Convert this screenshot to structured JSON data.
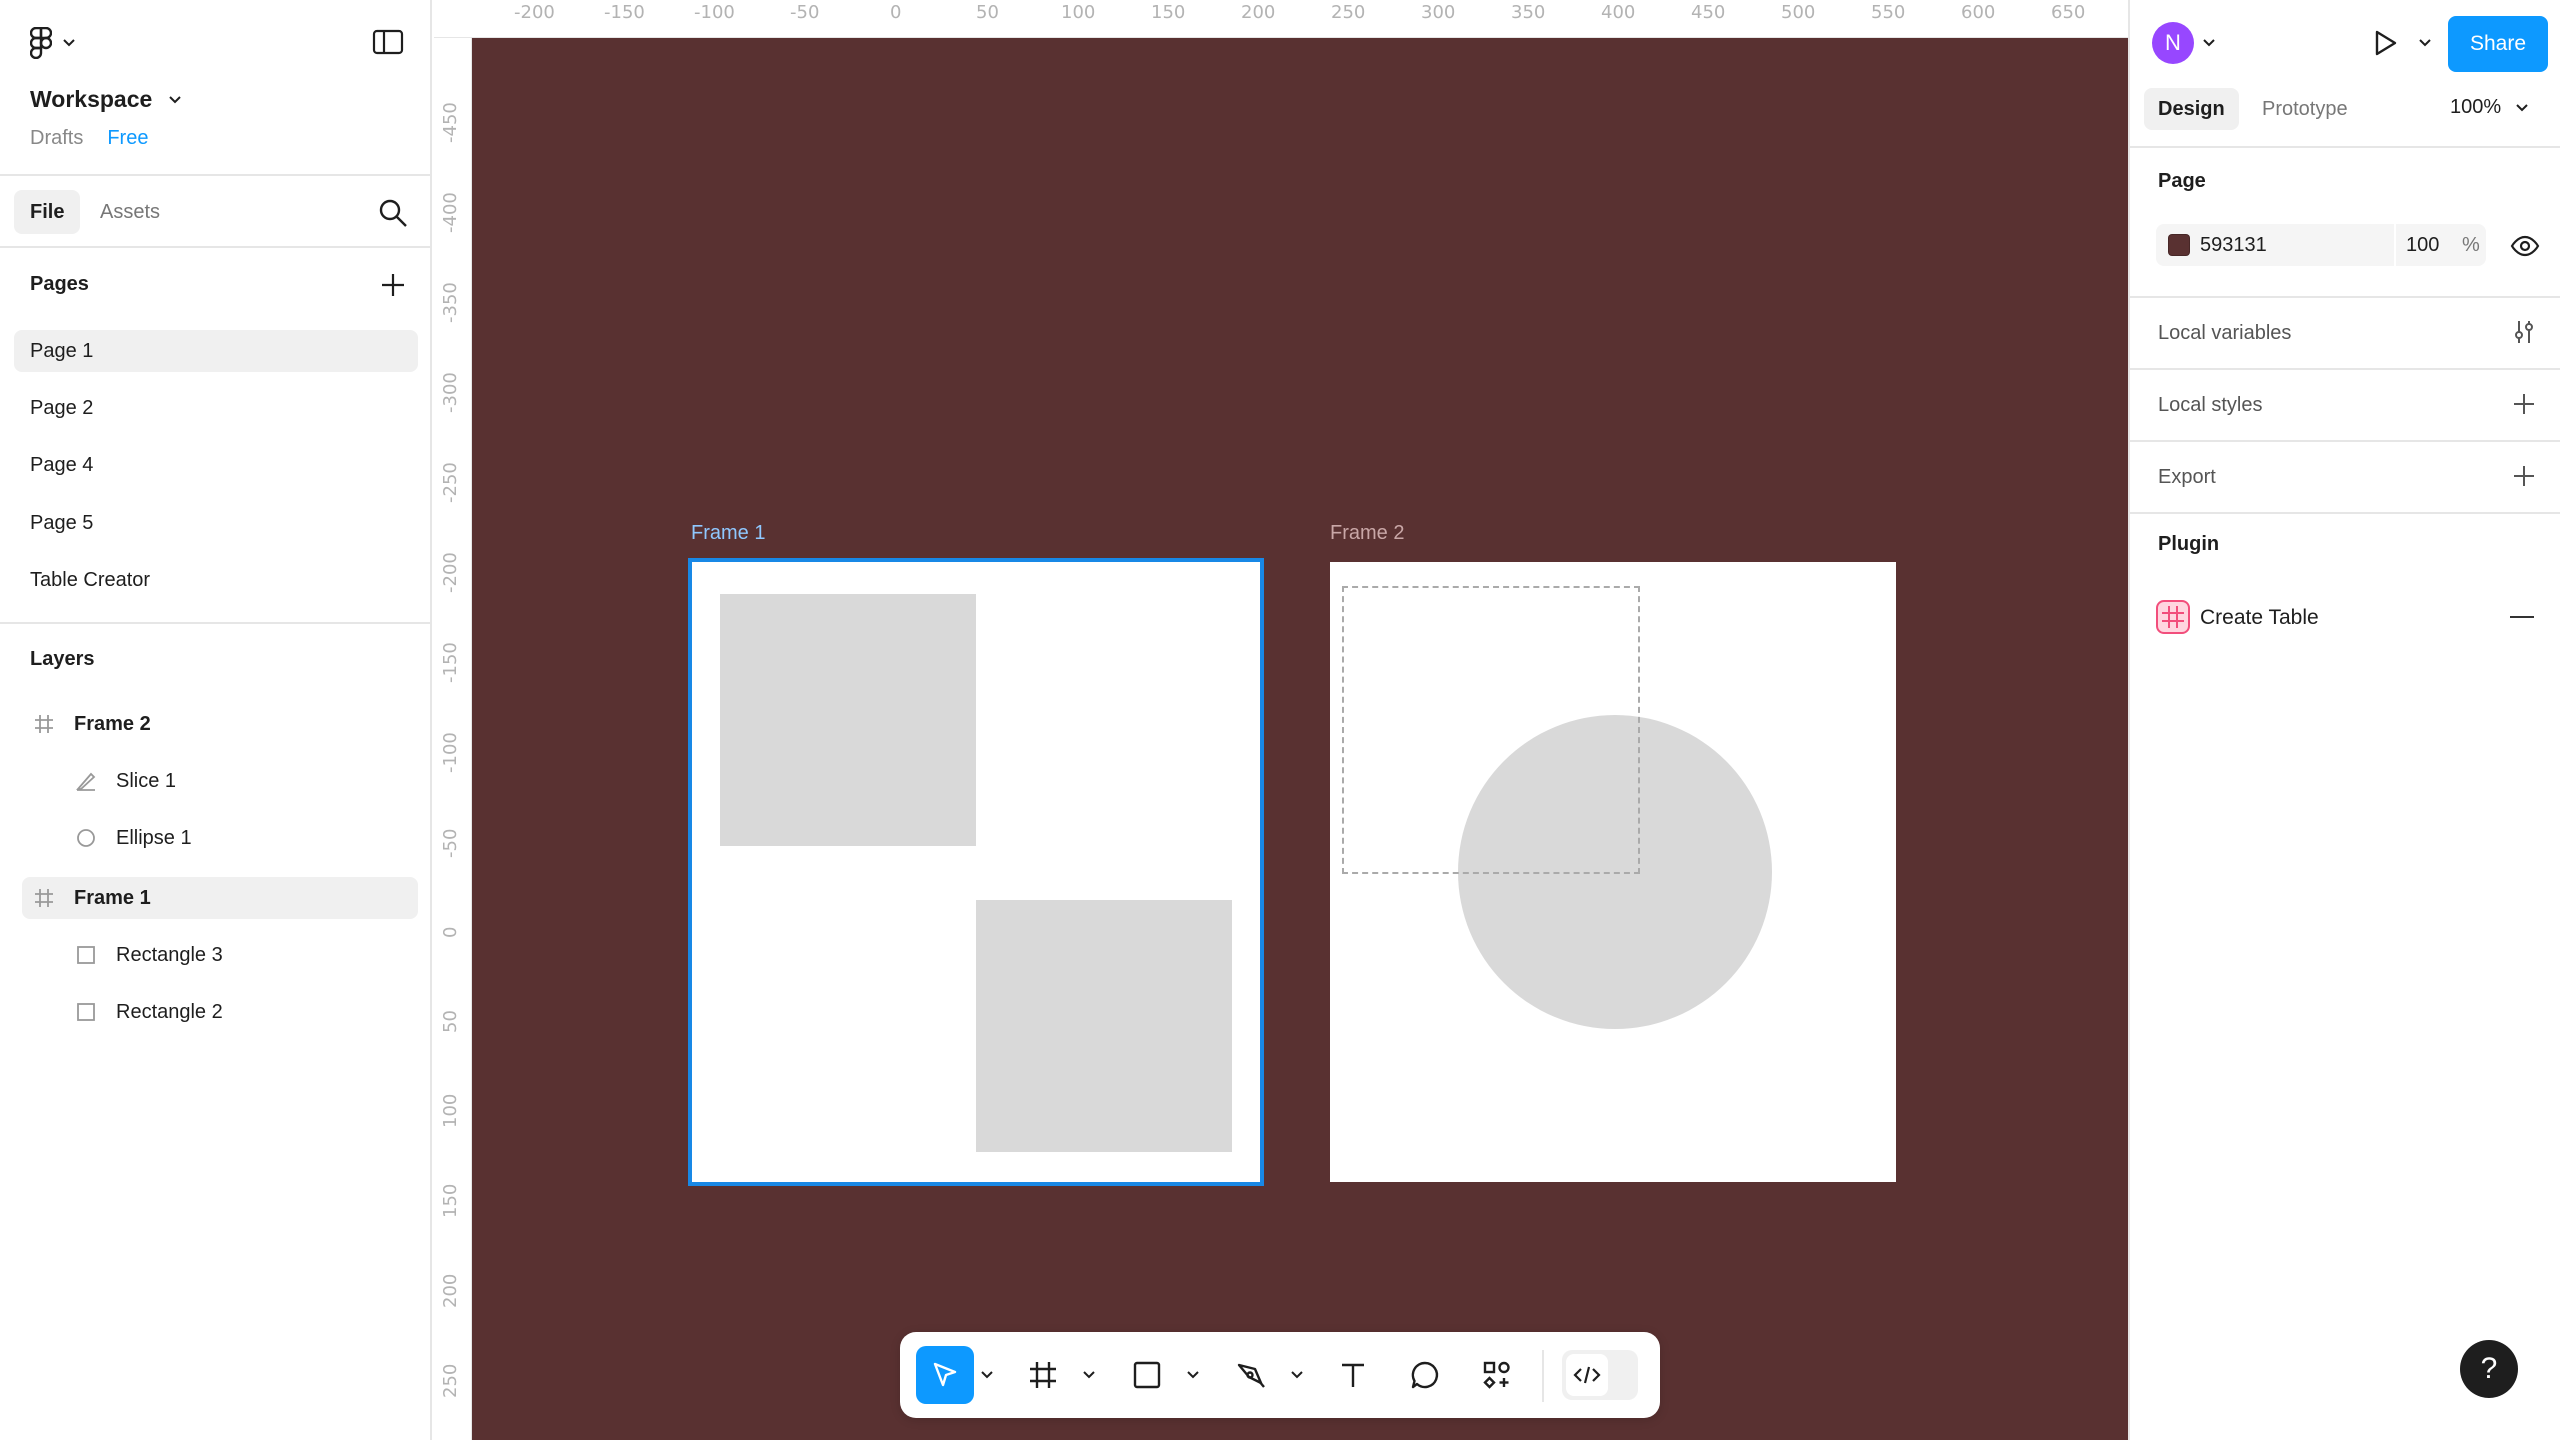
{
  "workspace": {
    "name": "Workspace",
    "drafts": "Drafts",
    "plan": "Free"
  },
  "left_tabs": {
    "file": "File",
    "assets": "Assets"
  },
  "pages": {
    "title": "Pages",
    "items": [
      "Page 1",
      "Page 2",
      "Page 4",
      "Page 5",
      "Table Creator"
    ]
  },
  "layers": {
    "title": "Layers",
    "items": [
      {
        "label": "Frame 2",
        "type": "frame"
      },
      {
        "label": "Slice 1",
        "type": "slice"
      },
      {
        "label": "Ellipse 1",
        "type": "ellipse"
      },
      {
        "label": "Frame 1",
        "type": "frame"
      },
      {
        "label": "Rectangle 3",
        "type": "rectangle"
      },
      {
        "label": "Rectangle 2",
        "type": "rectangle"
      }
    ]
  },
  "ruler": {
    "top": [
      "-200",
      "-150",
      "-100",
      "-50",
      "0",
      "50",
      "100",
      "150",
      "200",
      "250",
      "300",
      "350",
      "400",
      "450",
      "500",
      "550",
      "600",
      "650"
    ],
    "left": [
      "-450",
      "-400",
      "-350",
      "-300",
      "-250",
      "-200",
      "-150",
      "-100",
      "-50",
      "0",
      "50",
      "100",
      "150",
      "200",
      "250"
    ]
  },
  "canvas": {
    "background": "#593131",
    "frame1_label": "Frame 1",
    "frame2_label": "Frame 2"
  },
  "right": {
    "avatar": "N",
    "share": "Share",
    "tabs": {
      "design": "Design",
      "prototype": "Prototype"
    },
    "zoom": "100%",
    "page_section": "Page",
    "page_color_hex": "593131",
    "page_opacity": "100",
    "page_opacity_unit": "%",
    "local_variables": "Local variables",
    "local_styles": "Local styles",
    "export": "Export",
    "plugin_section": "Plugin",
    "plugin_name": "Create Table"
  },
  "colors": {
    "accent": "#0d99ff",
    "selection": "#1888e6",
    "canvas": "#593131",
    "avatar": "#9747ff"
  },
  "help": "?"
}
